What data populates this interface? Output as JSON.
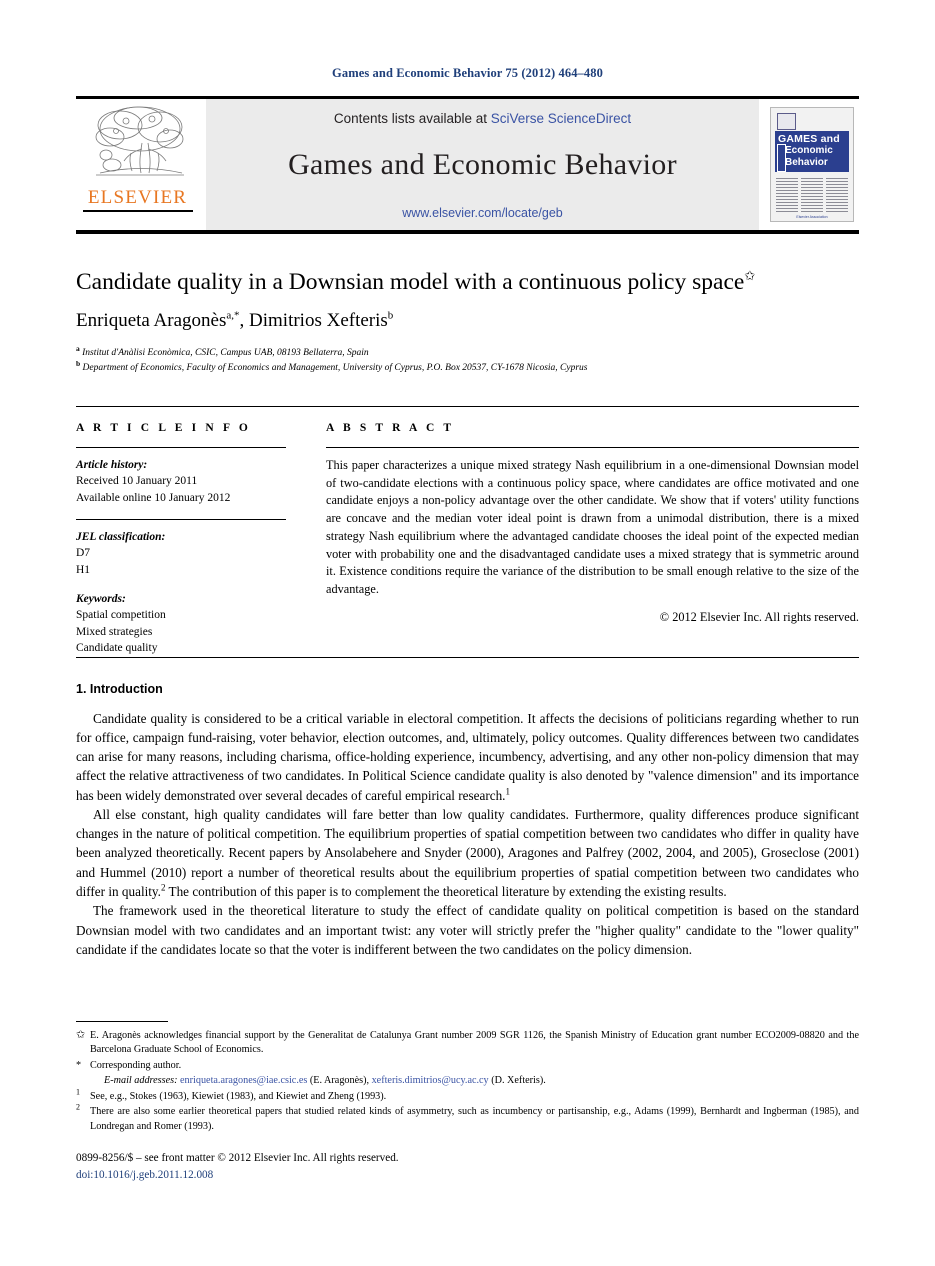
{
  "running_head": "Games and Economic Behavior 75 (2012) 464–480",
  "masthead": {
    "contents_prefix": "Contents lists available at ",
    "contents_link": "SciVerse ScienceDirect",
    "journal_name": "Games and Economic Behavior",
    "journal_url": "www.elsevier.com/locate/geb",
    "publisher_logo_text": "ELSEVIER",
    "cover": {
      "line1": "GAMES and",
      "line2": "Economic",
      "line3": "Behavior",
      "footer": "Elsevier Association"
    }
  },
  "article": {
    "title": "Candidate quality in a Downsian model with a continuous policy space",
    "title_footnote_mark": "✩",
    "authors": "Enriqueta Aragonès",
    "author1_sup": "a,*",
    "author2": "Dimitrios Xefteris",
    "author2_sup": "b",
    "affiliation_a_mark": "a",
    "affiliation_a": "Institut d'Anàlisi Econòmica, CSIC, Campus UAB, 08193 Bellaterra, Spain",
    "affiliation_b_mark": "b",
    "affiliation_b": "Department of Economics, Faculty of Economics and Management, University of Cyprus, P.O. Box 20537, CY-1678 Nicosia, Cyprus"
  },
  "info": {
    "heading": "A R T I C L E  I N F O",
    "history_label": "Article history:",
    "history_lines": [
      "Received 10 January 2011",
      "Available online 10 January 2012"
    ],
    "jel_label": "JEL classification:",
    "jel_codes": [
      "D7",
      "H1"
    ],
    "keywords_label": "Keywords:",
    "keywords": [
      "Spatial competition",
      "Mixed strategies",
      "Candidate quality"
    ]
  },
  "abstract": {
    "heading": "A B S T R A C T",
    "text": "This paper characterizes a unique mixed strategy Nash equilibrium in a one-dimensional Downsian model of two-candidate elections with a continuous policy space, where candidates are office motivated and one candidate enjoys a non-policy advantage over the other candidate. We show that if voters' utility functions are concave and the median voter ideal point is drawn from a unimodal distribution, there is a mixed strategy Nash equilibrium where the advantaged candidate chooses the ideal point of the expected median voter with probability one and the disadvantaged candidate uses a mixed strategy that is symmetric around it. Existence conditions require the variance of the distribution to be small enough relative to the size of the advantage.",
    "copyright": "© 2012 Elsevier Inc. All rights reserved."
  },
  "body": {
    "section_heading": "1. Introduction",
    "paragraphs": [
      "Candidate quality is considered to be a critical variable in electoral competition. It affects the decisions of politicians regarding whether to run for office, campaign fund-raising, voter behavior, election outcomes, and, ultimately, policy outcomes. Quality differences between two candidates can arise for many reasons, including charisma, office-holding experience, incumbency, advertising, and any other non-policy dimension that may affect the relative attractiveness of two candidates. In Political Science candidate quality is also denoted by \"valence dimension\" and its importance has been widely demonstrated over several decades of careful empirical research.",
      "All else constant, high quality candidates will fare better than low quality candidates. Furthermore, quality differences produce significant changes in the nature of political competition. The equilibrium properties of spatial competition between two candidates who differ in quality have been analyzed theoretically. Recent papers by Ansolabehere and Snyder (2000), Aragones and Palfrey (2002, 2004, and 2005), Groseclose (2001) and Hummel (2010) report a number of theoretical results about the equilibrium properties of spatial competition between two candidates who differ in quality.",
      "The framework used in the theoretical literature to study the effect of candidate quality on political competition is based on the standard Downsian model with two candidates and an important twist: any voter will strictly prefer the \"higher quality\" candidate to the \"lower quality\" candidate if the candidates locate so that the voter is indifferent between the two candidates on the policy dimension."
    ],
    "para1_footnote_mark": "1",
    "para2_footnote_mark": "2",
    "para2_tail": " The contribution of this paper is to complement the theoretical literature by extending the existing results."
  },
  "footnotes": {
    "star_mark": "✩",
    "star_text": "E. Aragonès acknowledges financial support by the Generalitat de Catalunya Grant number 2009 SGR 1126, the Spanish Ministry of Education grant number ECO2009-08820 and the Barcelona Graduate School of Economics.",
    "corresponding_mark": "*",
    "corresponding_text": "Corresponding author.",
    "email_label": "E-mail addresses:",
    "email1": "enriqueta.aragones@iae.csic.es",
    "email1_who": "(E. Aragonès)",
    "email2": "xefteris.dimitrios@ucy.ac.cy",
    "email2_who": "(D. Xefteris)",
    "fn1_mark": "1",
    "fn1_text": "See, e.g., Stokes (1963), Kiewiet (1983), and Kiewiet and Zheng (1993).",
    "fn2_mark": "2",
    "fn2_text": "There are also some earlier theoretical papers that studied related kinds of asymmetry, such as incumbency or partisanship, e.g., Adams (1999), Bernhardt and Ingberman (1985), and Londregan and Romer (1993)."
  },
  "imprint": {
    "issn_line": "0899-8256/$ – see front matter © 2012 Elsevier Inc. All rights reserved.",
    "doi": "doi:10.1016/j.geb.2011.12.008"
  },
  "colors": {
    "link": "#3a53a4",
    "running_head": "#1f3f7a",
    "elsevier_orange": "#e87722",
    "masthead_grey": "#ebebeb",
    "cover_blue": "#2b3f8f"
  }
}
